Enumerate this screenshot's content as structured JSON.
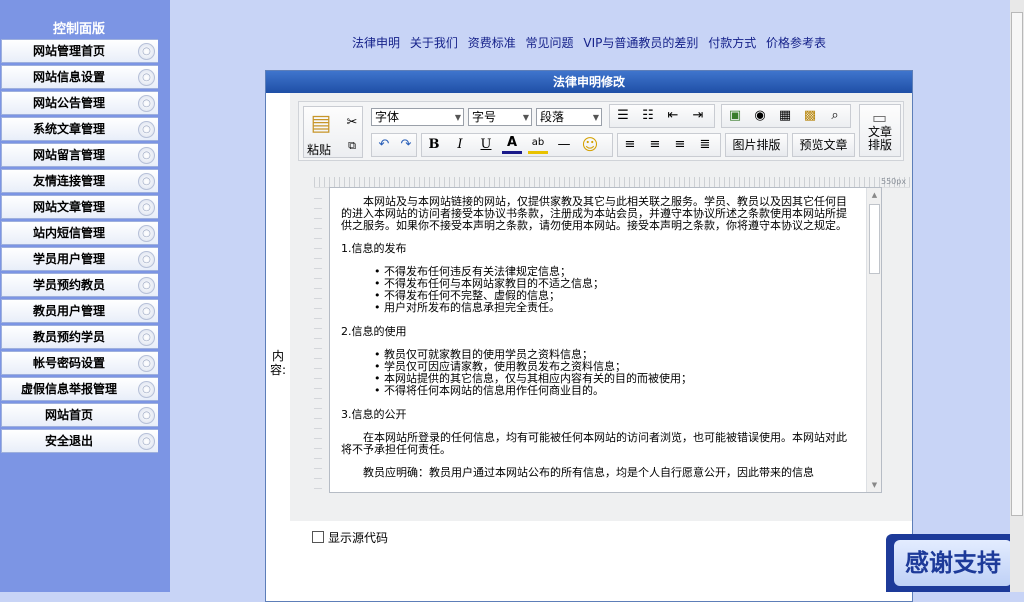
{
  "sidebar": {
    "title": "控制面版",
    "items": [
      {
        "label": "网站管理首页"
      },
      {
        "label": "网站信息设置"
      },
      {
        "label": "网站公告管理"
      },
      {
        "label": "系统文章管理"
      },
      {
        "label": "网站留言管理"
      },
      {
        "label": "友情连接管理"
      },
      {
        "label": "网站文章管理"
      },
      {
        "label": "站内短信管理"
      },
      {
        "label": "学员用户管理"
      },
      {
        "label": "学员预约教员"
      },
      {
        "label": "教员用户管理"
      },
      {
        "label": "教员预约学员"
      },
      {
        "label": "帐号密码设置"
      },
      {
        "label": "虚假信息举报管理"
      },
      {
        "label": "网站首页"
      },
      {
        "label": "安全退出"
      }
    ]
  },
  "toplinks": [
    "法律申明",
    "关于我们",
    "资费标准",
    "常见问题",
    "VIP与普通教员的差别",
    "付款方式",
    "价格参考表"
  ],
  "panel": {
    "title": "法律申明修改",
    "content_label": "内容:"
  },
  "toolbar": {
    "paste": "粘贴",
    "font": "字体",
    "size": "字号",
    "paragraph": "段落",
    "image_layout": "图片排版",
    "preview": "预览文章",
    "article_layout_1": "文章",
    "article_layout_2": "排版",
    "bold": "B",
    "italic": "I",
    "underline": "U"
  },
  "ruler_label": "550px",
  "document": {
    "intro": "本网站及与本网站链接的网站，仅提供家教及其它与此相关联之服务。学员、教员以及因其它任何目的进入本网站的访问者接受本协议书条款，注册成为本站会员，并遵守本协议所述之条款使用本网站所提供之服务。如果你不接受本声明之条款，请勿使用本网站。接受本声明之条款，你将遵守本协议之规定。",
    "sec1_title": "1.信息的发布",
    "sec1_items": [
      "不得发布任何违反有关法律规定信息；",
      "不得发布任何与本网站家教目的不适之信息；",
      "不得发布任何不完整、虚假的信息；",
      "用户对所发布的信息承担完全责任。"
    ],
    "sec2_title": "2.信息的使用",
    "sec2_items": [
      "教员仅可就家教目的使用学员之资料信息；",
      "学员仅可因应请家教，使用教员发布之资料信息；",
      "本网站提供的其它信息，仅与其相应内容有关的目的而被使用；",
      "不得将任何本网站的信息用作任何商业目的。"
    ],
    "sec3_title": "3.信息的公开",
    "sec3_text": "在本网站所登录的任何信息，均有可能被任何本网站的访问者浏览，也可能被错误使用。本网站对此将不予承担任何责任。",
    "sec3_more": "教员应明确：教员用户通过本网站公布的所有信息，均是个人自行愿意公开，因此带来的信息"
  },
  "show_source": "显示源代码",
  "thanks": "感谢支持"
}
